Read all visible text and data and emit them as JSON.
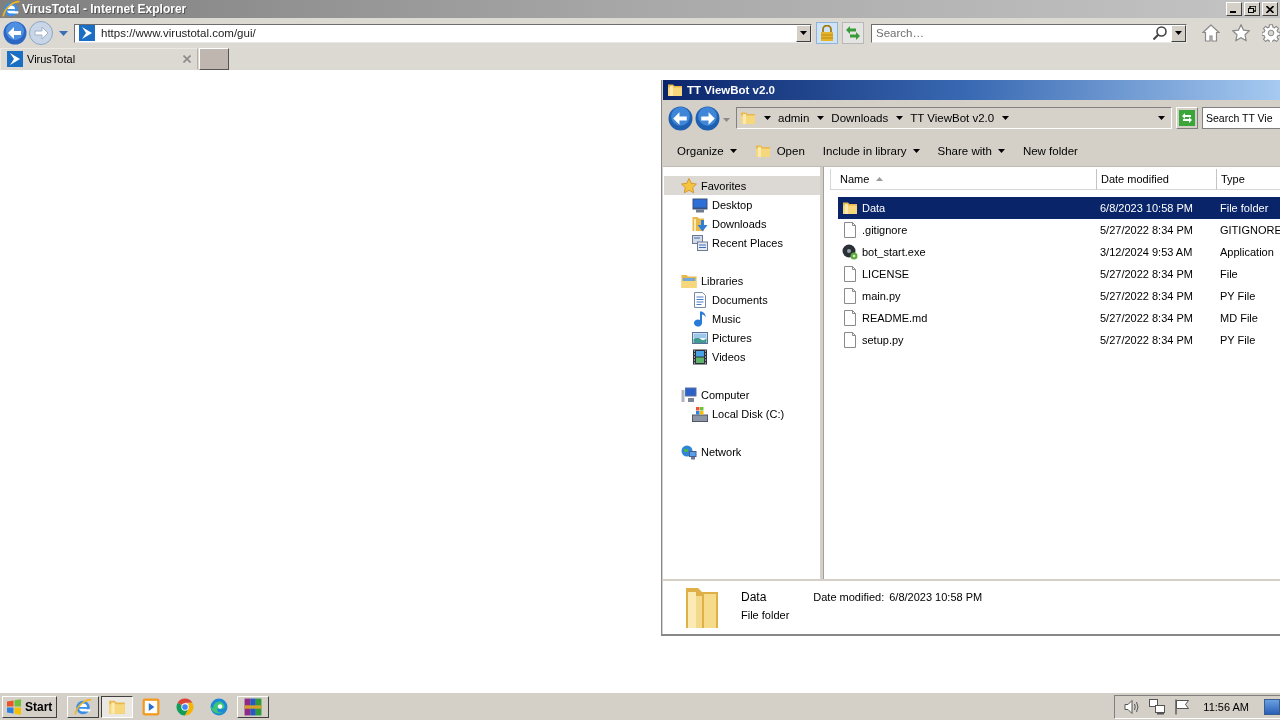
{
  "browser": {
    "title": "VirusTotal - Internet Explorer",
    "address": "https://www.virustotal.com/gui/",
    "search": {
      "placeholder": "Search…"
    },
    "tabs": [
      {
        "label": "VirusTotal",
        "selected": true
      }
    ]
  },
  "explorer": {
    "title": "TT ViewBot v2.0",
    "breadcrumb": [
      "admin",
      "Downloads",
      "TT ViewBot v2.0"
    ],
    "search": {
      "placeholder": "Search TT Vie"
    },
    "toolbar": [
      {
        "label": "Organize",
        "kind": "dropdown"
      },
      {
        "label": "Open",
        "kind": "icon"
      },
      {
        "label": "Include in library",
        "kind": "dropdown"
      },
      {
        "label": "Share with",
        "kind": "dropdown"
      },
      {
        "label": "New folder",
        "kind": "plain"
      }
    ],
    "nav": [
      {
        "label": "Favorites",
        "selected": true,
        "children": [
          {
            "label": "Desktop",
            "selected": false
          },
          {
            "label": "Downloads",
            "selected": false
          },
          {
            "label": "Recent Places",
            "selected": false
          }
        ]
      },
      {
        "label": "Libraries",
        "selected": false,
        "children": [
          {
            "label": "Documents",
            "selected": false
          },
          {
            "label": "Music",
            "selected": false
          },
          {
            "label": "Pictures",
            "selected": false
          },
          {
            "label": "Videos",
            "selected": false
          }
        ]
      },
      {
        "label": "Computer",
        "selected": false,
        "children": [
          {
            "label": "Local Disk (C:)",
            "selected": false
          }
        ]
      },
      {
        "label": "Network",
        "selected": false
      }
    ],
    "columns": [
      {
        "label": "Name",
        "sorted": true
      },
      {
        "label": "Date modified",
        "sorted": false
      },
      {
        "label": "Type",
        "sorted": false
      }
    ],
    "rows": [
      {
        "name": "Data",
        "date": "6/8/2023 10:58 PM",
        "type": "File folder",
        "kind": "folder",
        "selected": true
      },
      {
        "name": ".gitignore",
        "date": "5/27/2022 8:34 PM",
        "type": "GITIGNORE",
        "kind": "file",
        "selected": false
      },
      {
        "name": "bot_start.exe",
        "date": "3/12/2024 9:53 AM",
        "type": "Application",
        "kind": "application",
        "selected": false
      },
      {
        "name": "LICENSE",
        "date": "5/27/2022 8:34 PM",
        "type": "File",
        "kind": "file",
        "selected": false
      },
      {
        "name": "main.py",
        "date": "5/27/2022 8:34 PM",
        "type": "PY File",
        "kind": "file",
        "selected": false
      },
      {
        "name": "README.md",
        "date": "5/27/2022 8:34 PM",
        "type": "MD File",
        "kind": "file",
        "selected": false
      },
      {
        "name": "setup.py",
        "date": "5/27/2022 8:34 PM",
        "type": "PY File",
        "kind": "file",
        "selected": false
      }
    ],
    "details": {
      "name": "Data",
      "date_label": "Date modified:",
      "date": "6/8/2023 10:58 PM",
      "type": "File folder"
    }
  },
  "taskbar": {
    "start": "Start",
    "apps": [
      {
        "open": true,
        "selected": false
      },
      {
        "open": true,
        "selected": true
      },
      {
        "open": false,
        "selected": false
      },
      {
        "open": false,
        "selected": false
      },
      {
        "open": false,
        "selected": false
      },
      {
        "open": true,
        "selected": false
      }
    ],
    "clock": "11:56 AM"
  }
}
